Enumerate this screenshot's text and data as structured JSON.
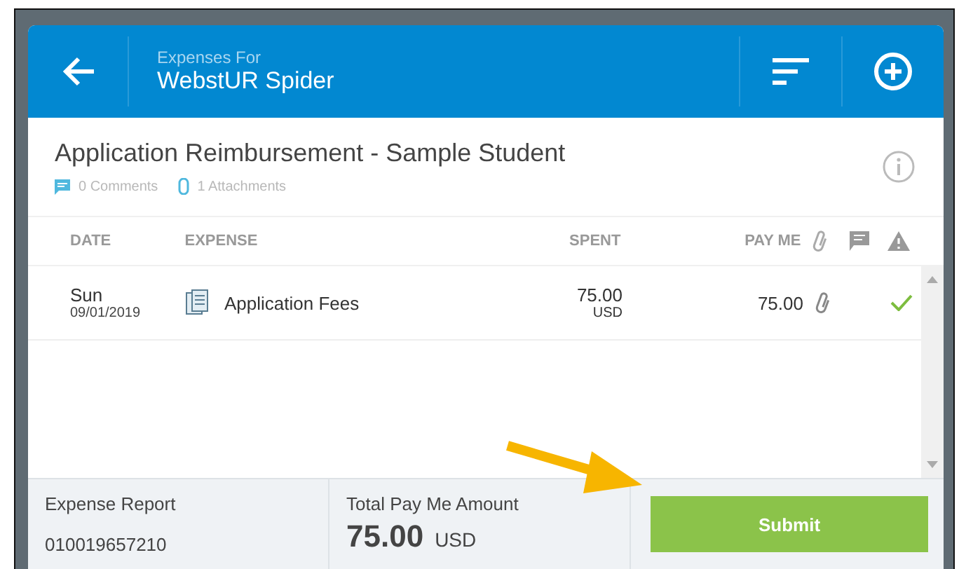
{
  "header": {
    "subtitle": "Expenses For",
    "title": "WebstUR Spider"
  },
  "report": {
    "title": "Application Reimbursement - Sample Student",
    "comments": "0 Comments",
    "attachments": "1 Attachments"
  },
  "table": {
    "columns": [
      "DATE",
      "EXPENSE",
      "SPENT",
      "PAY ME"
    ],
    "rows": [
      {
        "day": "Sun",
        "date": "09/01/2019",
        "expense": "Application Fees",
        "spent": "75.00",
        "currency": "USD",
        "pay_me": "75.00",
        "attachment": true,
        "checked": true
      }
    ]
  },
  "footer": {
    "report_label": "Expense Report",
    "report_number": "010019657210",
    "total_label": "Total Pay Me Amount",
    "total": "75.00",
    "total_currency": "USD",
    "button": "Submit"
  }
}
